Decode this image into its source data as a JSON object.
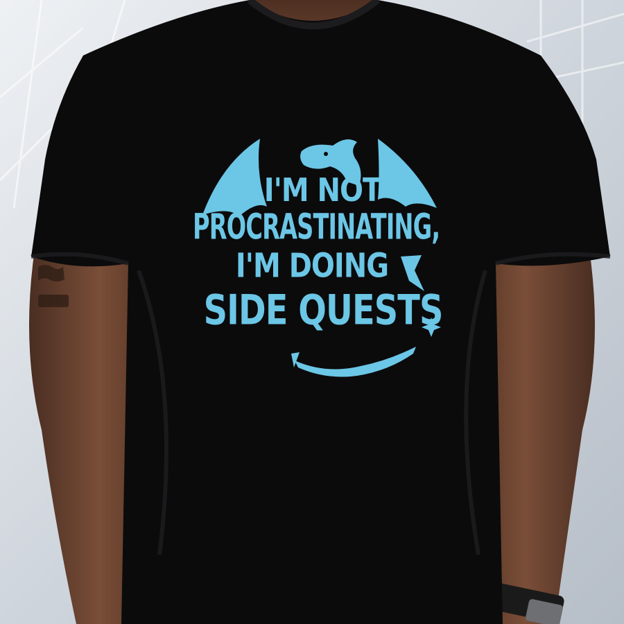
{
  "shirt_print": {
    "lines": [
      "I'M NOT",
      "PROCRASTINATING,",
      "I'M DOING",
      "SIDE QUESTS"
    ]
  },
  "colors": {
    "shirt": "#0b0b0c",
    "print": "#6cc6e6",
    "skin": "#6e4632",
    "background": "#d9dde2"
  },
  "icons": [
    "dragon-icon",
    "sparkle-icon",
    "watch-icon"
  ]
}
